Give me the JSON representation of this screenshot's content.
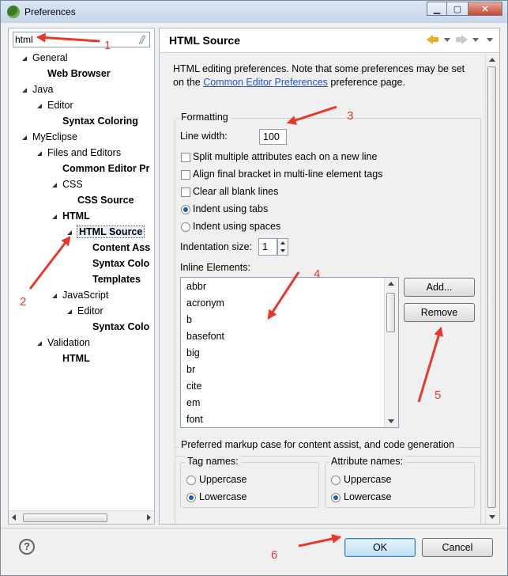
{
  "window": {
    "title": "Preferences"
  },
  "filter": {
    "value": "html"
  },
  "tree": {
    "items": [
      {
        "label": "General",
        "level": 1,
        "bold": false,
        "open": true
      },
      {
        "label": "Web Browser",
        "level": 2,
        "bold": true,
        "open": false
      },
      {
        "label": "Java",
        "level": 1,
        "bold": false,
        "open": true
      },
      {
        "label": "Editor",
        "level": 2,
        "bold": false,
        "open": true
      },
      {
        "label": "Syntax Coloring",
        "level": 3,
        "bold": true,
        "open": false
      },
      {
        "label": "MyEclipse",
        "level": 1,
        "bold": false,
        "open": true
      },
      {
        "label": "Files and Editors",
        "level": 2,
        "bold": false,
        "open": true
      },
      {
        "label": "Common Editor Pr",
        "level": 3,
        "bold": true,
        "open": false
      },
      {
        "label": "CSS",
        "level": 3,
        "bold": false,
        "open": true
      },
      {
        "label": "CSS Source",
        "level": 4,
        "bold": true,
        "open": false
      },
      {
        "label": "HTML",
        "level": 3,
        "bold": true,
        "open": true
      },
      {
        "label": "HTML Source",
        "level": 4,
        "bold": true,
        "open": true,
        "selected": true
      },
      {
        "label": "Content Ass",
        "level": 5,
        "bold": true,
        "open": false
      },
      {
        "label": "Syntax Colo",
        "level": 5,
        "bold": true,
        "open": false
      },
      {
        "label": "Templates",
        "level": 5,
        "bold": true,
        "open": false
      },
      {
        "label": "JavaScript",
        "level": 3,
        "bold": false,
        "open": true
      },
      {
        "label": "Editor",
        "level": 4,
        "bold": false,
        "open": true
      },
      {
        "label": "Syntax Colo",
        "level": 5,
        "bold": true,
        "open": false
      },
      {
        "label": "Validation",
        "level": 2,
        "bold": false,
        "open": true
      },
      {
        "label": "HTML",
        "level": 3,
        "bold": true,
        "open": false
      }
    ]
  },
  "page": {
    "title": "HTML Source",
    "desc_before": "HTML editing preferences.  Note that some preferences may be set on the ",
    "desc_link": "Common Editor Preferences",
    "desc_after": " preference page."
  },
  "formatting": {
    "group_label": "Formatting",
    "line_width_label": "Line width:",
    "line_width_value": "100",
    "split_attrs": "Split multiple attributes each on a new line",
    "align_bracket": "Align final bracket in multi-line element tags",
    "clear_blank": "Clear all blank lines",
    "indent_tabs": "Indent using tabs",
    "indent_spaces": "Indent using spaces",
    "indent_size_label": "Indentation size:",
    "indent_size_value": "1",
    "inline_label": "Inline Elements:",
    "inline_elements": [
      "abbr",
      "acronym",
      "b",
      "basefont",
      "big",
      "br",
      "cite",
      "em",
      "font"
    ],
    "add_label": "Add...",
    "remove_label": "Remove"
  },
  "markup_case": {
    "group_label": "Preferred markup case for content assist, and code generation",
    "tag_names": {
      "label": "Tag names:",
      "upper": "Uppercase",
      "lower": "Lowercase"
    },
    "attr_names": {
      "label": "Attribute names:",
      "upper": "Uppercase",
      "lower": "Lowercase"
    }
  },
  "footer": {
    "help": "?",
    "ok": "OK",
    "cancel": "Cancel"
  },
  "annotations": [
    "1",
    "2",
    "3",
    "4",
    "5",
    "6"
  ],
  "colors": {
    "annotation": "#e8382a",
    "accent": "#3c7fb1"
  }
}
